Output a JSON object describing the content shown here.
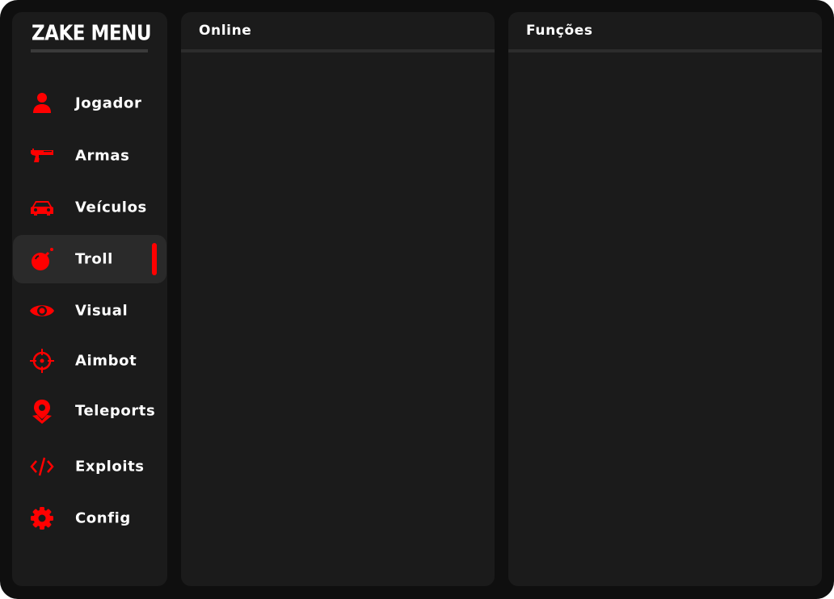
{
  "app": {
    "title": "ZAKE MENU"
  },
  "colors": {
    "accent": "#ff0000",
    "panel": "#1b1b1b",
    "background": "#0f0f0f",
    "active_item": "#2a2a2a"
  },
  "sidebar": {
    "items": [
      {
        "label": "Jogador",
        "icon": "user-icon",
        "active": false
      },
      {
        "label": "Armas",
        "icon": "pistol-icon",
        "active": false
      },
      {
        "label": "Veículos",
        "icon": "car-icon",
        "active": false
      },
      {
        "label": "Troll",
        "icon": "bomb-icon",
        "active": true
      },
      {
        "label": "Visual",
        "icon": "eye-icon",
        "active": false
      },
      {
        "label": "Aimbot",
        "icon": "crosshair-icon",
        "active": false
      },
      {
        "label": "Teleports",
        "icon": "map-pin-icon",
        "active": false
      },
      {
        "label": "Exploits",
        "icon": "code-icon",
        "active": false
      },
      {
        "label": "Config",
        "icon": "gear-icon",
        "active": false
      }
    ]
  },
  "panels": {
    "online": {
      "title": "Online"
    },
    "functions": {
      "title": "Funções"
    }
  }
}
